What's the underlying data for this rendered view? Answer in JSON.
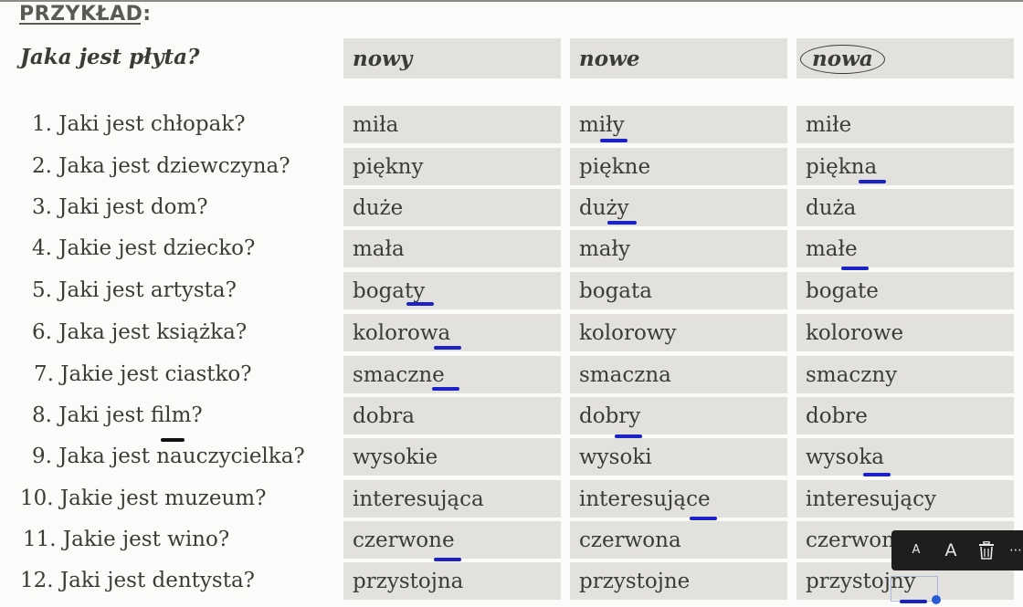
{
  "heading": "PRZYKŁAD:",
  "example": {
    "question": "Jaka jest płyta?",
    "options": [
      "nowy",
      "nowe",
      "nowa"
    ]
  },
  "rows": [
    {
      "q": "1. Jaki jest chłopak?",
      "a": "miła",
      "b": "miły",
      "c": "miłe"
    },
    {
      "q": "2. Jaka jest dziewczyna?",
      "a": "piękny",
      "b": "piękne",
      "c": "piękna"
    },
    {
      "q": "3. Jaki jest dom?",
      "a": "duże",
      "b": "duży",
      "c": "duża"
    },
    {
      "q": "4. Jakie jest dziecko?",
      "a": "mała",
      "b": "mały",
      "c": "małe"
    },
    {
      "q": "5. Jaki jest artysta?",
      "a": "bogaty",
      "b": "bogata",
      "c": "bogate"
    },
    {
      "q": "6. Jaka jest książka?",
      "a": "kolorowa",
      "b": "kolorowy",
      "c": "kolorowe"
    },
    {
      "q": "7. Jakie jest ciastko?",
      "a": "smaczne",
      "b": "smaczna",
      "c": "smaczny"
    },
    {
      "q": "8. Jaki jest film?",
      "a": "dobra",
      "b": "dobry",
      "c": "dobre"
    },
    {
      "q": "9. Jaka jest nauczycielka?",
      "a": "wysokie",
      "b": "wysoki",
      "c": "wysoka"
    },
    {
      "q": "10. Jakie jest muzeum?",
      "a": "interesująca",
      "b": "interesujące",
      "c": "interesujący"
    },
    {
      "q": "11. Jakie jest wino?",
      "a": "czerwone",
      "b": "czerwona",
      "c": "czerwon"
    },
    {
      "q": "12. Jaki jest dentysta?",
      "a": "przystojna",
      "b": "przystojne",
      "c": "przystojny"
    }
  ],
  "toolbar": {
    "small_a": "A",
    "large_a": "A",
    "delete_icon": "trash-icon",
    "more_icon": "more-icon"
  },
  "colors": {
    "cell_bg": "#e2e1de",
    "ink": "#1a22c8",
    "page_bg": "#fbfbf9"
  }
}
